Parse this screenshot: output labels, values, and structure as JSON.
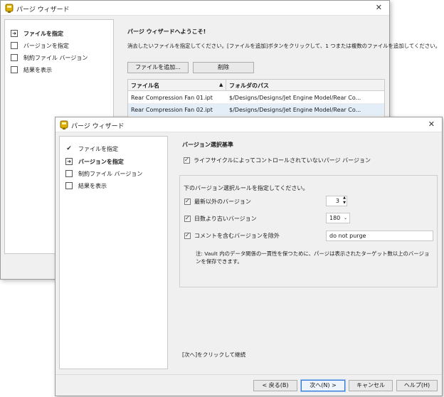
{
  "back_window": {
    "title": "パージ ウィザード",
    "nav": [
      "ファイルを指定",
      "バージョンを指定",
      "制約ファイル バージョン",
      "結果を表示"
    ],
    "heading": "パージ ウィザードへようこそ!",
    "instruction": "消去したいファイルを指定してください。[ファイルを追加]ボタンをクリックして、1 つまたは複数のファイルを追加してください。",
    "add_button": "ファイルを追加...",
    "delete_button": "削除",
    "columns": [
      "ファイル名",
      "フォルダのパス"
    ],
    "rows": [
      {
        "name": "Rear Compression Fan 01.ipt",
        "path": "$/Designs/Designs/Jet Engine Model/Rear Co..."
      },
      {
        "name": "Rear Compression Fan 02.ipt",
        "path": "$/Designs/Designs/Jet Engine Model/Rear Co..."
      }
    ]
  },
  "front_window": {
    "title": "パージ ウィザード",
    "nav": [
      "ファイルを指定",
      "バージョンを指定",
      "制約ファイル バージョン",
      "結果を表示"
    ],
    "section_title": "バージョン選択基準",
    "lifecycle_option": "ライフサイクルによってコントロールされていないパージ バージョン",
    "rules_prompt": "下のバージョン選択ルールを指定してください。",
    "rule_latest": "最新以外のバージョン",
    "rule_latest_value": "3",
    "rule_days": "日数より古いバージョン",
    "rule_days_value": "180",
    "rule_comment": "コメントを含むバージョンを除外",
    "rule_comment_value": "do not purge",
    "note": "注: Vault 内のデータ関係の一貫性を保つために、パージは表示されたターゲット数以上のバージョンを保存できます。",
    "continue_hint": "[次へ]をクリックして継続",
    "buttons": {
      "back": "< 戻る(B)",
      "next": "次へ(N) >",
      "cancel": "キャンセル",
      "help": "ヘルプ(H)"
    }
  },
  "colors": {
    "accent": "#3478d6",
    "selected_row": "#e3eef9",
    "logo": "#e0b000"
  }
}
